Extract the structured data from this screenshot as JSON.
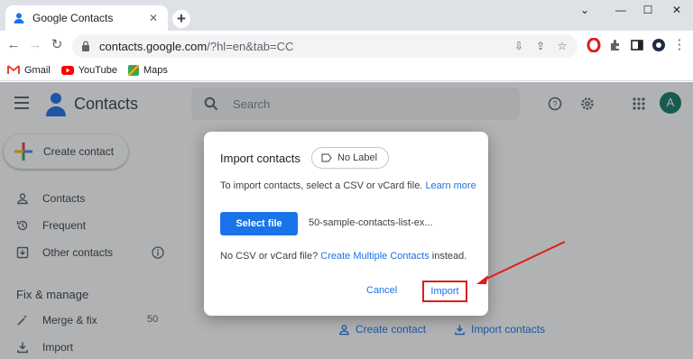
{
  "browser": {
    "tab_title": "Google Contacts",
    "url_host": "contacts.google.com",
    "url_rest": "/?hl=en&tab=CC",
    "bookmarks": [
      "Gmail",
      "YouTube",
      "Maps"
    ]
  },
  "header": {
    "app_name": "Contacts",
    "search_placeholder": "Search",
    "avatar_letter": "A"
  },
  "sidebar": {
    "create_label": "Create contact",
    "items": [
      {
        "label": "Contacts"
      },
      {
        "label": "Frequent"
      },
      {
        "label": "Other contacts"
      }
    ],
    "section": "Fix & manage",
    "manage_items": [
      {
        "label": "Merge & fix",
        "count": "50"
      },
      {
        "label": "Import"
      }
    ]
  },
  "main": {
    "create_link": "Create contact",
    "import_link": "Import contacts"
  },
  "dialog": {
    "title": "Import contacts",
    "label_chip": "No Label",
    "description": "To import contacts, select a CSV or vCard file.",
    "learn_more": "Learn more",
    "select_file": "Select file",
    "filename": "50-sample-contacts-list-ex...",
    "no_file_text": "No CSV or vCard file?",
    "create_multiple": "Create Multiple Contacts",
    "instead": "instead.",
    "cancel": "Cancel",
    "import": "Import"
  },
  "colors": {
    "accent": "#1a73e8",
    "highlight": "#e01b1b",
    "avatar": "#137a64"
  }
}
